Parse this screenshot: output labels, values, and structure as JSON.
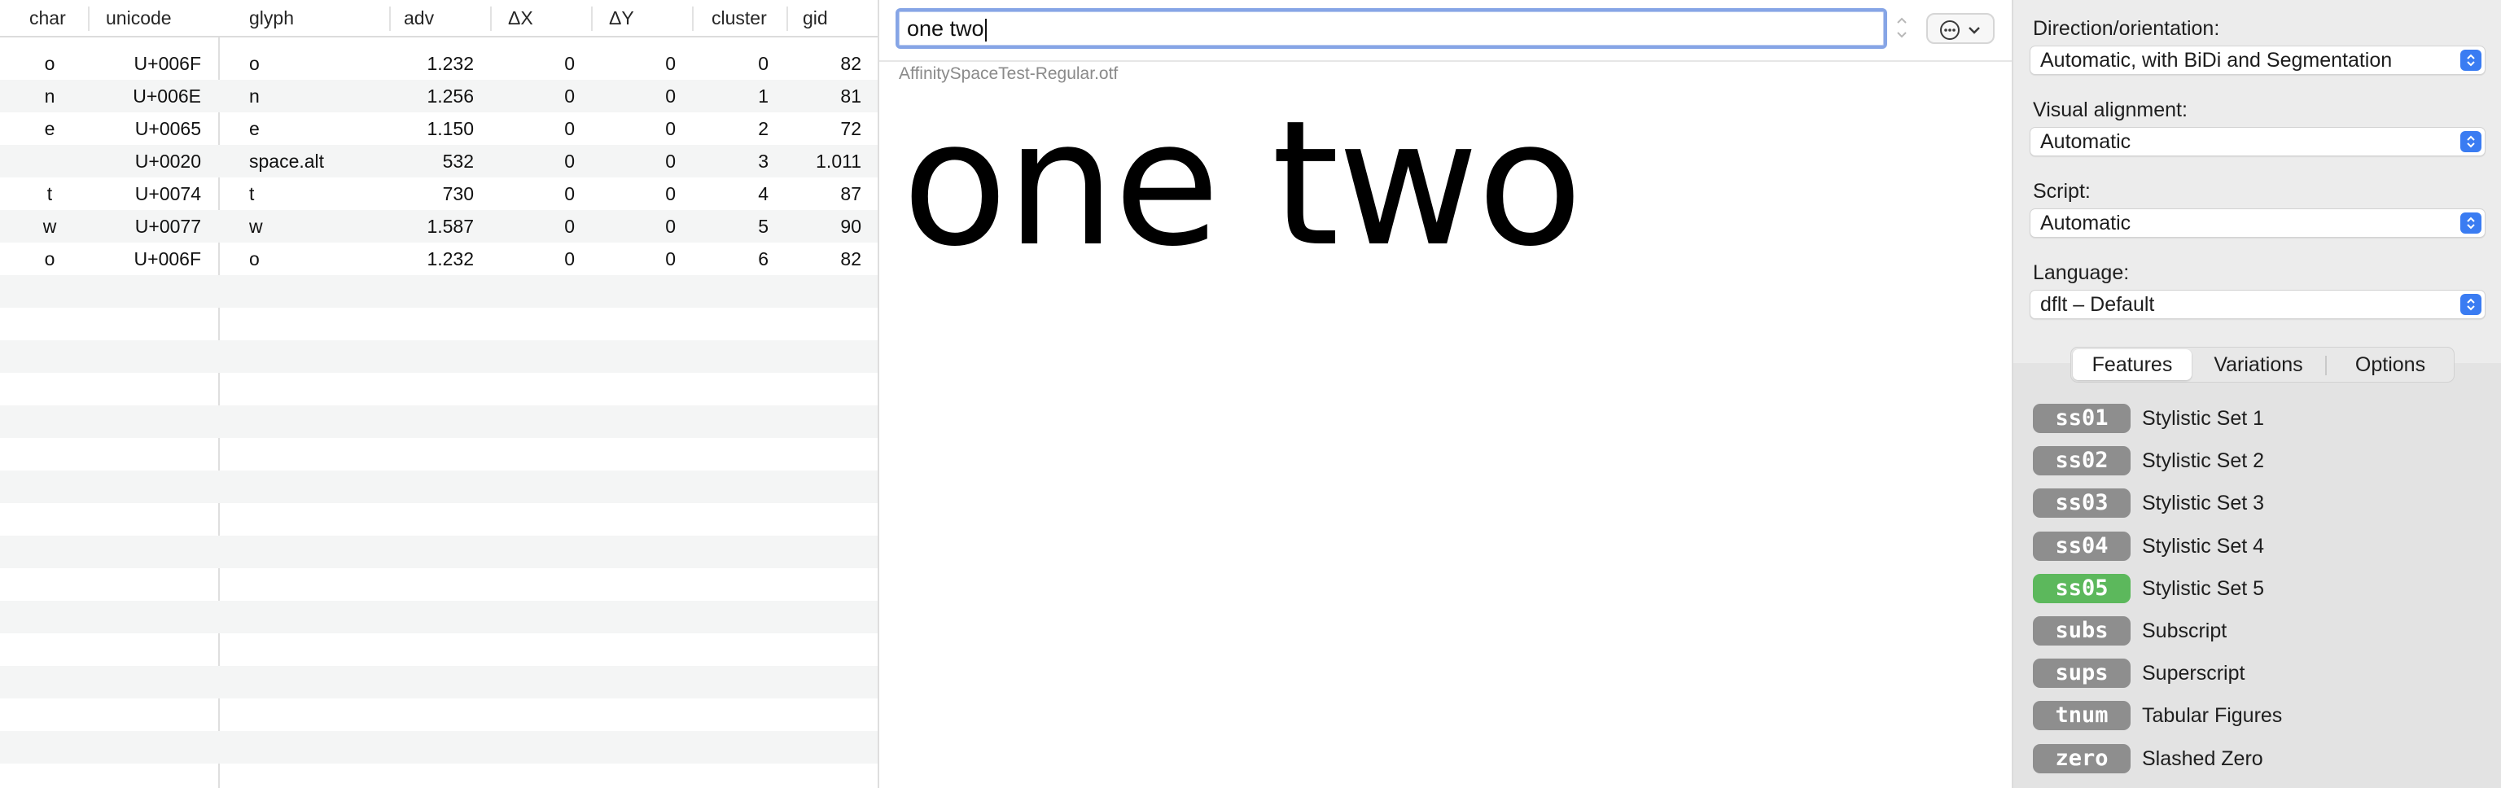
{
  "table": {
    "headers": [
      "char",
      "unicode",
      "glyph",
      "adv",
      "ΔX",
      "ΔY",
      "cluster",
      "gid"
    ],
    "rows": [
      {
        "char": "o",
        "unicode": "U+006F",
        "glyph": "o",
        "adv": "1.232",
        "dx": "0",
        "dy": "0",
        "cluster": "0",
        "gid": "82"
      },
      {
        "char": "n",
        "unicode": "U+006E",
        "glyph": "n",
        "adv": "1.256",
        "dx": "0",
        "dy": "0",
        "cluster": "1",
        "gid": "81"
      },
      {
        "char": "e",
        "unicode": "U+0065",
        "glyph": "e",
        "adv": "1.150",
        "dx": "0",
        "dy": "0",
        "cluster": "2",
        "gid": "72"
      },
      {
        "char": "",
        "unicode": "U+0020",
        "glyph": "space.alt",
        "adv": "532",
        "dx": "0",
        "dy": "0",
        "cluster": "3",
        "gid": "1.011"
      },
      {
        "char": "t",
        "unicode": "U+0074",
        "glyph": "t",
        "adv": "730",
        "dx": "0",
        "dy": "0",
        "cluster": "4",
        "gid": "87"
      },
      {
        "char": "w",
        "unicode": "U+0077",
        "glyph": "w",
        "adv": "1.587",
        "dx": "0",
        "dy": "0",
        "cluster": "5",
        "gid": "90"
      },
      {
        "char": "o",
        "unicode": "U+006F",
        "glyph": "o",
        "adv": "1.232",
        "dx": "0",
        "dy": "0",
        "cluster": "6",
        "gid": "82"
      }
    ]
  },
  "input": {
    "text": "one two"
  },
  "font_file": "AffinitySpaceTest-Regular.otf",
  "preview_text": "one two",
  "settings": {
    "direction_label": "Direction/orientation:",
    "direction_value": "Automatic, with BiDi and Segmentation",
    "alignment_label": "Visual alignment:",
    "alignment_value": "Automatic",
    "script_label": "Script:",
    "script_value": "Automatic",
    "language_label": "Language:",
    "language_value": "dflt – Default"
  },
  "tabs": [
    "Features",
    "Variations",
    "Options"
  ],
  "features": [
    {
      "tag": "ss01",
      "name": "Stylistic Set 1",
      "active": false
    },
    {
      "tag": "ss02",
      "name": "Stylistic Set 2",
      "active": false
    },
    {
      "tag": "ss03",
      "name": "Stylistic Set 3",
      "active": false
    },
    {
      "tag": "ss04",
      "name": "Stylistic Set 4",
      "active": false
    },
    {
      "tag": "ss05",
      "name": "Stylistic Set 5",
      "active": true
    },
    {
      "tag": "subs",
      "name": "Subscript",
      "active": false
    },
    {
      "tag": "sups",
      "name": "Superscript",
      "active": false
    },
    {
      "tag": "tnum",
      "name": "Tabular Figures",
      "active": false
    },
    {
      "tag": "zero",
      "name": "Slashed Zero",
      "active": false
    }
  ],
  "colors": {
    "accent": "#3a7cf2",
    "feature_on": "#5cb85c",
    "feature_off": "#8e8e8e",
    "focus_ring": "#86a5e6"
  },
  "icons": {
    "more_button": "ellipsis-circle-icon",
    "more_chevron": "chevron-down-icon",
    "popup_arrows": "up-down-chevron-icon",
    "stepper": "stepper-icon"
  }
}
